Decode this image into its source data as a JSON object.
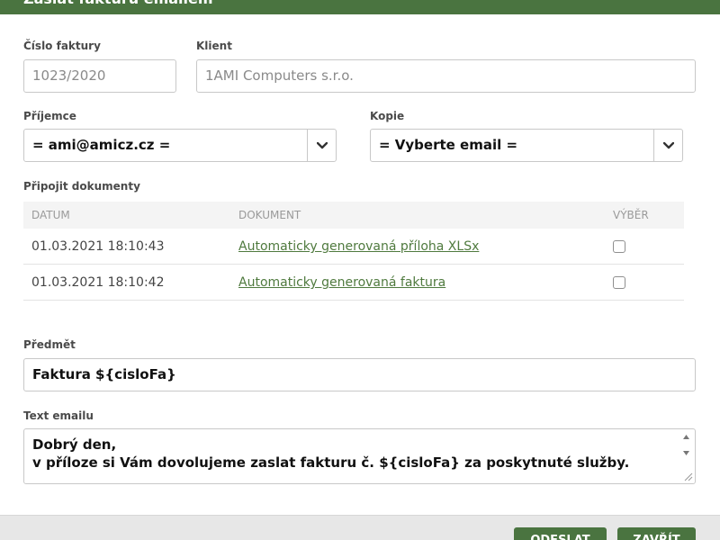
{
  "dialog": {
    "title": "Zaslat fakturu emailem"
  },
  "invoice": {
    "label": "Číslo faktury",
    "value": "1023/2020"
  },
  "client": {
    "label": "Klient",
    "value": "1AMI Computers s.r.o."
  },
  "recipient": {
    "label": "Příjemce",
    "selected": "= ami@amicz.cz =",
    "icon": "chevron-down-icon"
  },
  "copy": {
    "label": "Kopie",
    "selected": "= Vyberte email =",
    "icon": "chevron-down-icon"
  },
  "attachments": {
    "label": "Připojit dokumenty",
    "columns": [
      "DATUM",
      "DOKUMENT",
      "VÝBĚR"
    ],
    "rows": [
      {
        "date": "01.03.2021 18:10:43",
        "document": "Automaticky generovaná příloha XLSx",
        "selected": false
      },
      {
        "date": "01.03.2021 18:10:42",
        "document": "Automaticky generovaná faktura",
        "selected": false
      }
    ]
  },
  "subject": {
    "label": "Předmět",
    "value": "Faktura ${cisloFa}"
  },
  "body": {
    "label": "Text emailu",
    "lines": [
      "Dobrý den,",
      "v příloze si Vám dovolujeme zaslat fakturu č. ${cisloFa} za poskytnuté služby."
    ]
  },
  "footer": {
    "send_label": "ODESLAT",
    "close_label": "ZAVŘÍT"
  },
  "colors": {
    "accent": "#4a7440",
    "link": "#4f7a3e"
  }
}
